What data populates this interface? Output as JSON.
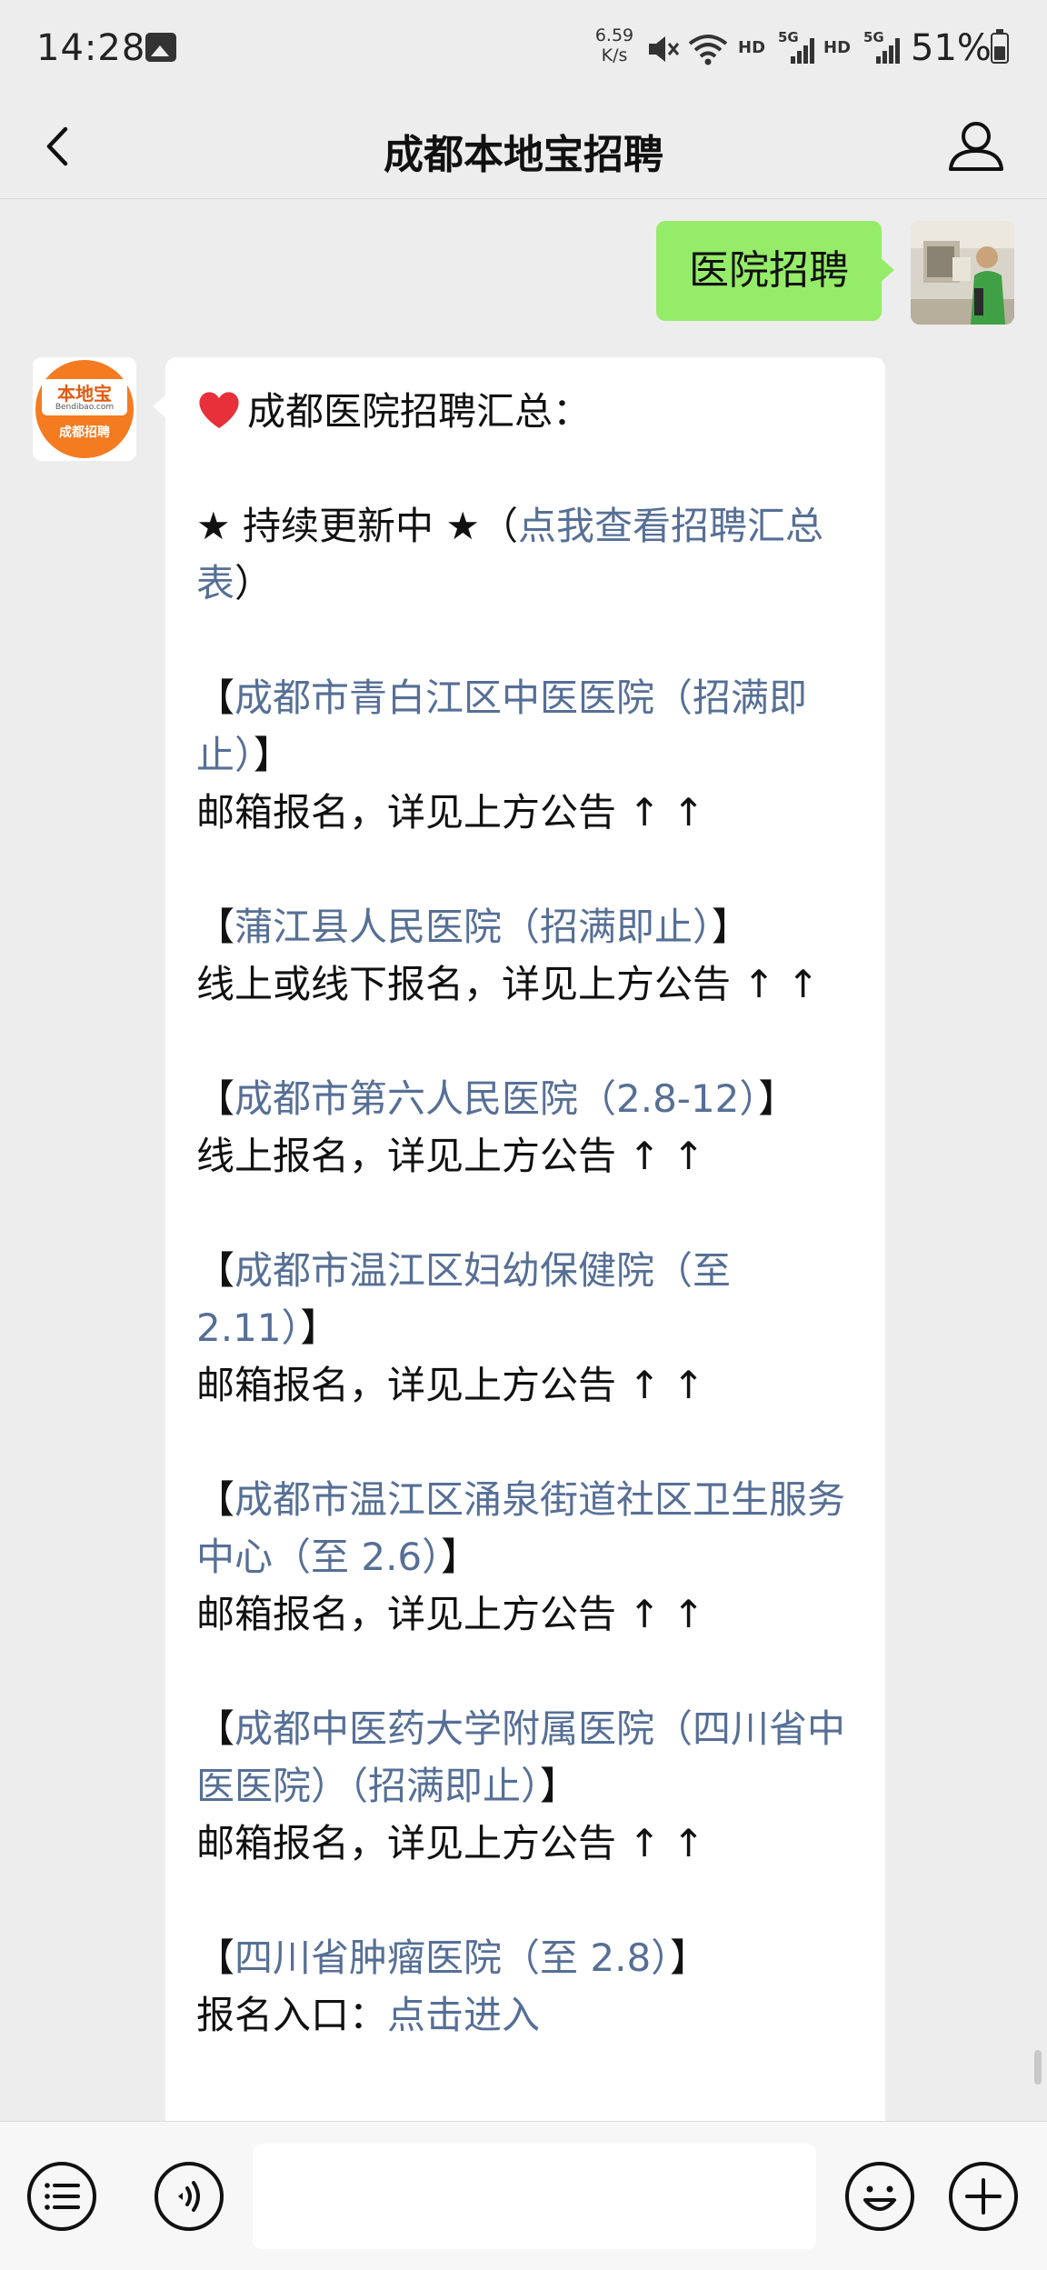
{
  "status_bar": {
    "time": "14:28",
    "net_speed_value": "6.59",
    "net_speed_unit": "K/s",
    "hd_label": "HD",
    "signal_label": "5G",
    "battery": "51%",
    "battery_level": 0.51
  },
  "nav": {
    "title": "成都本地宝招聘"
  },
  "chat": {
    "outgoing": {
      "text": "医院招聘"
    },
    "incoming": {
      "avatar_brand": "本地宝",
      "avatar_site": "Bendibao.com",
      "avatar_sub": "成都招聘",
      "heading": "成都医院招聘汇总：",
      "update_prefix": "★ 持续更新中 ★（",
      "update_link": "点我查看招聘汇总表",
      "update_suffix": "）",
      "entries": [
        {
          "name": "成都市青白江区中医医院（招满即止）",
          "note": "邮箱报名，详见上方公告 ↑ ↑"
        },
        {
          "name": "蒲江县人民医院（招满即止）",
          "note": "线上或线下报名，详见上方公告 ↑ ↑"
        },
        {
          "name": "成都市第六人民医院（2.8-12）",
          "note": "线上报名，详见上方公告 ↑ ↑"
        },
        {
          "name": "成都市温江区妇幼保健院（至 2.11）",
          "note": "邮箱报名，详见上方公告 ↑ ↑"
        },
        {
          "name": "成都市温江区涌泉街道社区卫生服务中心（至 2.6）",
          "note": "邮箱报名，详见上方公告 ↑ ↑"
        },
        {
          "name": "成都中医药大学附属医院（四川省中医医院）（招满即止）",
          "note": "邮箱报名，详见上方公告 ↑ ↑"
        },
        {
          "name": "四川省肿瘤医院（至 2.8）",
          "note_prefix": "报名入口：",
          "note_link": "点击进入"
        }
      ]
    }
  },
  "bracket_open": "【",
  "bracket_close": "】",
  "icons": {
    "back": "chevron-left-icon",
    "profile": "user-icon",
    "menu": "list-icon",
    "voice": "voice-icon",
    "emoji": "emoji-icon",
    "plus": "plus-icon"
  },
  "colors": {
    "outgoing_bubble": "#95ec69",
    "link": "#566f96",
    "brand_orange": "#f47b20"
  }
}
